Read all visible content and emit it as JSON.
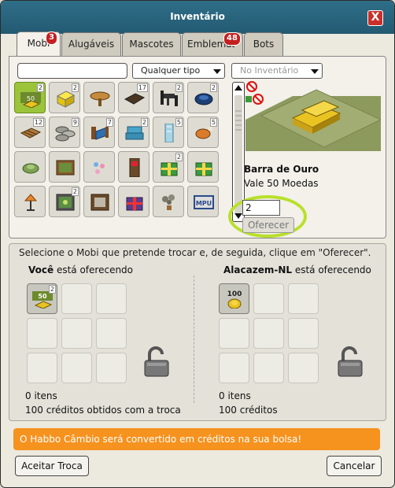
{
  "window": {
    "title": "Inventário",
    "close_label": "X"
  },
  "tabs": [
    {
      "label": "Mobi",
      "badge": "3",
      "active": true
    },
    {
      "label": "Alugáveis",
      "badge": ""
    },
    {
      "label": "Mascotes",
      "badge": ""
    },
    {
      "label": "Emblemas",
      "badge": "48"
    },
    {
      "label": "Bots",
      "badge": ""
    }
  ],
  "filters": {
    "search_value": "",
    "type_select": "Qualquer tipo",
    "location_select": "No Inventário"
  },
  "items": [
    {
      "icon": "gold-bar-stack-icon",
      "count": "2",
      "selected": true
    },
    {
      "icon": "yellow-cube-icon",
      "count": "2"
    },
    {
      "icon": "round-wooden-table-icon",
      "count": ""
    },
    {
      "icon": "dark-rug-icon",
      "count": "17"
    },
    {
      "icon": "dark-table-chairs-icon",
      "count": "2"
    },
    {
      "icon": "blue-lamp-icon",
      "count": "2"
    },
    {
      "icon": "wooden-pallet-icon",
      "count": "12"
    },
    {
      "icon": "sandbags-icon",
      "count": "9"
    },
    {
      "icon": "blue-bed-icon",
      "count": "7"
    },
    {
      "icon": "blue-armchair-icon",
      "count": "2"
    },
    {
      "icon": "glass-panel-icon",
      "count": "5"
    },
    {
      "icon": "roast-chicken-icon",
      "count": "5"
    },
    {
      "icon": "plant-ball-icon",
      "count": ""
    },
    {
      "icon": "wooden-frame-icon",
      "count": ""
    },
    {
      "icon": "ribbon-decor-icon",
      "count": ""
    },
    {
      "icon": "arcade-cabinet-icon",
      "count": ""
    },
    {
      "icon": "green-gift-box-icon",
      "count": "2"
    },
    {
      "icon": "green-gift-box-icon",
      "count": ""
    },
    {
      "icon": "orange-lamp-icon",
      "count": ""
    },
    {
      "icon": "green-safe-icon",
      "count": "2"
    },
    {
      "icon": "picture-frame-icon",
      "count": ""
    },
    {
      "icon": "purple-gift-box-icon",
      "count": ""
    },
    {
      "icon": "small-plant-icon",
      "count": ""
    },
    {
      "icon": "tv-screen-icon",
      "count": ""
    }
  ],
  "tv_label": "MPU",
  "selected_item": {
    "name": "Barra de Ouro",
    "value_text": "Vale 50 Moedas",
    "quantity": "2",
    "offer_button": "Oferecer"
  },
  "trade": {
    "instruction": "Selecione o Mobi que pretende trocar e, de seguida, clique em \"Oferecer\".",
    "left": {
      "user": "Você",
      "suffix": " está oferecendo",
      "slot_item": {
        "icon": "gold-bar-icon",
        "label": "50",
        "count": "2"
      },
      "items_count": "0 itens",
      "credits": "100 créditos obtidos com a troca"
    },
    "right": {
      "user": "Alacazem-NL",
      "suffix": " está oferecendo",
      "slot_item": {
        "icon": "coin-stack-icon",
        "label": "100"
      },
      "items_count": "0 itens",
      "credits": "100 créditos"
    }
  },
  "notice": "O Habbo Câmbio será convertido em créditos na sua bolsa!",
  "buttons": {
    "accept": "Aceitar Troca",
    "cancel": "Cancelar"
  },
  "colors": {
    "titlebar": "#2a6680",
    "selected_item": "#9bc43a",
    "notice": "#f6921e",
    "badge": "#c41f20",
    "highlight": "#b9e02a"
  }
}
